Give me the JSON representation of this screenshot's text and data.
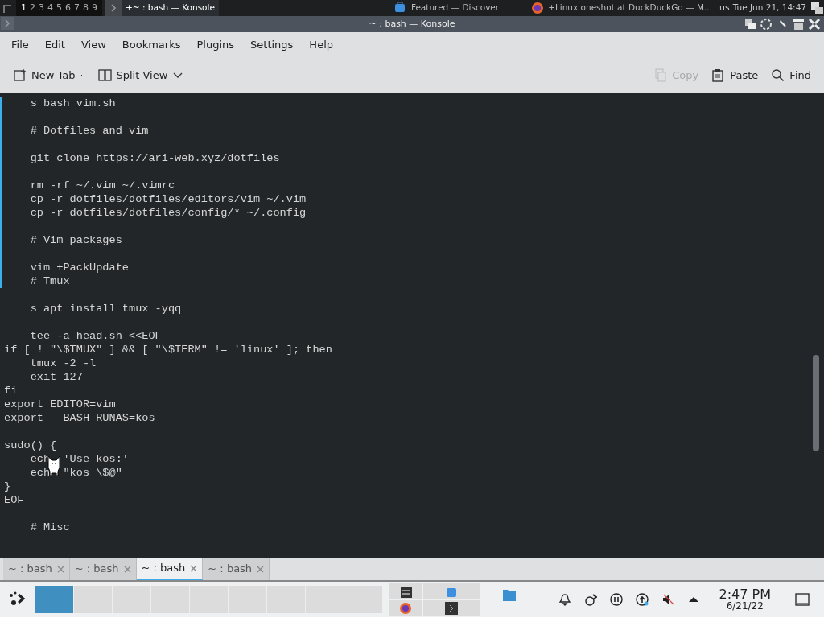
{
  "top_panel": {
    "desktops": [
      {
        "label": "1",
        "selected": true
      },
      {
        "label": "2",
        "selected": false
      },
      {
        "label": "3",
        "selected": false
      },
      {
        "label": "4",
        "selected": false
      },
      {
        "label": "5",
        "selected": false
      },
      {
        "label": "6",
        "selected": false
      },
      {
        "label": "7",
        "selected": false
      },
      {
        "label": "8",
        "selected": false
      },
      {
        "label": "9",
        "selected": false
      }
    ],
    "tasks": [
      {
        "kind": "terminal",
        "label": "+~ : bash — Konsole",
        "selected": true
      },
      {
        "kind": "store",
        "label": "Featured — Discover",
        "selected": false
      },
      {
        "kind": "browser",
        "label": "+Linux oneshot at DuckDuckGo — M...",
        "selected": false
      }
    ],
    "keyboard_layout": "us",
    "clock": "Tue Jun 21, 14:47"
  },
  "window": {
    "title": "~ : bash — Konsole"
  },
  "menu": [
    "File",
    "Edit",
    "View",
    "Bookmarks",
    "Plugins",
    "Settings",
    "Help"
  ],
  "toolbar": [
    {
      "kind": "newtab",
      "label": "New Tab",
      "disabled": false
    },
    {
      "kind": "split",
      "label": "Split View",
      "disabled": false
    },
    {
      "kind": "copy",
      "label": "Copy",
      "disabled": true
    },
    {
      "kind": "paste",
      "label": "Paste",
      "disabled": false
    },
    {
      "kind": "find",
      "label": "Find",
      "disabled": false
    }
  ],
  "terminal": {
    "lines": [
      {
        "text": "    s bash vim.sh",
        "space_before": false,
        "marked": true
      },
      {
        "text": "    # Dotfiles and vim",
        "space_before": true,
        "marked": true
      },
      {
        "text": "    git clone https://ari-web.xyz/dotfiles",
        "space_before": true,
        "marked": true
      },
      {
        "text": "    rm -rf ~/.vim ~/.vimrc",
        "space_before": true,
        "marked": true
      },
      {
        "text": "    cp -r dotfiles/dotfiles/editors/vim ~/.vim",
        "space_before": false,
        "marked": true
      },
      {
        "text": "    cp -r dotfiles/dotfiles/config/* ~/.config",
        "space_before": false,
        "marked": true
      },
      {
        "text": "    # Vim packages",
        "space_before": true,
        "marked": true
      },
      {
        "text": "    vim +PackUpdate",
        "space_before": true,
        "marked": true
      },
      {
        "text": "    # Tmux",
        "space_before": false,
        "marked": true
      },
      {
        "text": "    s apt install tmux -yqq",
        "space_before": true,
        "marked": false
      },
      {
        "text": "    tee -a head.sh <<EOF",
        "space_before": true,
        "marked": false
      },
      {
        "text": "if [ ! \"\\$TMUX\" ] && [ \"\\$TERM\" != 'linux' ]; then",
        "space_before": false,
        "marked": false
      },
      {
        "text": "    tmux -2 -l",
        "space_before": false,
        "marked": false
      },
      {
        "text": "    exit 127",
        "space_before": false,
        "marked": false
      },
      {
        "text": "fi",
        "space_before": false,
        "marked": false
      },
      {
        "text": "export EDITOR=vim",
        "space_before": false,
        "marked": false
      },
      {
        "text": "export __BASH_RUNAS=kos",
        "space_before": false,
        "marked": false
      },
      {
        "text": "sudo() {",
        "space_before": true,
        "marked": false
      },
      {
        "text": "    ech  'Use kos:'",
        "space_before": false,
        "marked": false,
        "cursor": true
      },
      {
        "text": "    ech  \"kos \\$@\"",
        "space_before": false,
        "marked": false
      },
      {
        "text": "}",
        "space_before": false,
        "marked": false
      },
      {
        "text": "EOF",
        "space_before": false,
        "marked": false
      },
      {
        "text": "    # Misc",
        "space_before": true,
        "marked": false
      }
    ]
  },
  "tabs": [
    {
      "label": "~ : bash",
      "selected": false
    },
    {
      "label": "~ : bash",
      "selected": false
    },
    {
      "label": "~ : bash",
      "selected": true
    },
    {
      "label": "~ : bash",
      "selected": false
    }
  ],
  "taskbar": {
    "pager": [
      {
        "selected": true
      },
      {
        "selected": false
      },
      {
        "selected": false
      },
      {
        "selected": false
      },
      {
        "selected": false
      },
      {
        "selected": false
      },
      {
        "selected": false
      },
      {
        "selected": false
      },
      {
        "selected": false
      }
    ],
    "time": "2:47 PM",
    "date": "6/21/22"
  }
}
